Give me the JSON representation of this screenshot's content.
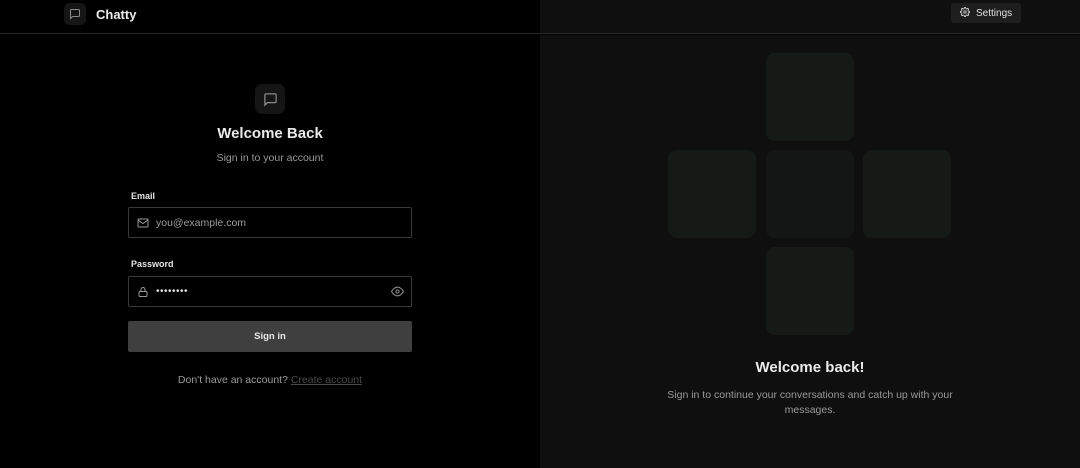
{
  "app": {
    "name": "Chatty"
  },
  "topbar": {
    "settings_label": "Settings"
  },
  "login": {
    "title": "Welcome Back",
    "subtitle": "Sign in to your account",
    "email_label": "Email",
    "email_placeholder": "you@example.com",
    "password_label": "Password",
    "password_value": "••••••••",
    "submit_label": "Sign in",
    "signup_prompt": "Don't have an account?",
    "signup_link": "Create account"
  },
  "promo": {
    "title": "Welcome back!",
    "text": "Sign in to continue your conversations and catch up with your messages."
  },
  "icons": {
    "brand": "chat-bubble-icon",
    "settings": "gear-icon",
    "email": "mail-icon",
    "password": "lock-icon",
    "reveal": "eye-icon"
  },
  "colors": {
    "background": "#000000",
    "panel": "#0f0f0f",
    "button": "#3f3f3f",
    "tile": "#151a17"
  }
}
